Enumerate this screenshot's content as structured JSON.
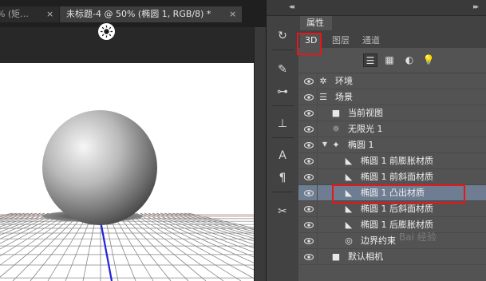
{
  "tabs": [
    {
      "label": "% (矩...",
      "close": "×"
    },
    {
      "label": "未标题-4 @ 50% (椭圆 1, RGB/8) *",
      "close": "×"
    }
  ],
  "properties_panel": {
    "title": "属性",
    "tabs": [
      {
        "label": "3D",
        "active": true
      },
      {
        "label": "图层",
        "active": false
      },
      {
        "label": "通道",
        "active": false
      }
    ],
    "filters": [
      "scene-icon",
      "mesh-icon",
      "material-icon",
      "light-icon"
    ]
  },
  "tool_strip": [
    "3d-rotate-icon",
    "brush-presets-icon",
    "adjustments-icon",
    "clone-source-icon",
    "character-icon",
    "paragraph-icon",
    "tools-icon"
  ],
  "scene_tree": [
    {
      "label": "环境",
      "icon": "environment-icon"
    },
    {
      "label": "场景",
      "icon": "scene-icon"
    },
    {
      "label": "当前视图",
      "icon": "camera-icon"
    },
    {
      "label": "无限光 1",
      "icon": "infinite-light-icon"
    },
    {
      "label": "椭圆 1",
      "icon": "mesh-icon",
      "expanded": true
    },
    {
      "label": "椭圆 1 前膨胀材质",
      "icon": "material-icon"
    },
    {
      "label": "椭圆 1 前斜面材质",
      "icon": "material-icon"
    },
    {
      "label": "椭圆 1 凸出材质",
      "icon": "material-icon",
      "selected": true
    },
    {
      "label": "椭圆 1 后斜面材质",
      "icon": "material-icon"
    },
    {
      "label": "椭圆 1 后膨胀材质",
      "icon": "material-icon"
    },
    {
      "label": "边界约束",
      "icon": "constraint-icon"
    },
    {
      "label": "默认相机",
      "icon": "camera-icon"
    }
  ],
  "watermark": "Bai 经验",
  "colors": {
    "selection_highlight": "#6e7d91",
    "annotation_red": "#e8151b",
    "panel_bg": "#535353"
  }
}
